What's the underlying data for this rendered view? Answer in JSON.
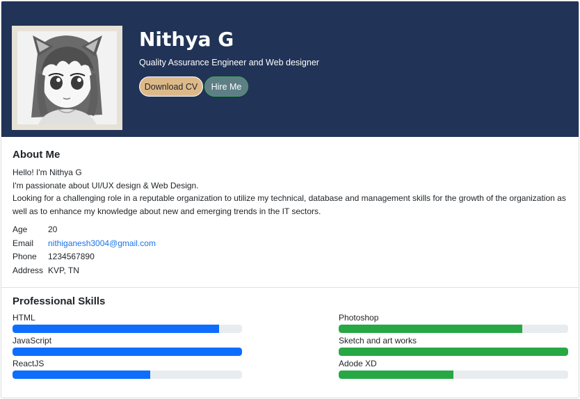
{
  "header": {
    "name": "Nithya G",
    "role": "Quality Assurance Engineer and Web designer",
    "download_label": "Download CV",
    "hire_label": "Hire Me"
  },
  "about": {
    "title": "About Me",
    "lines": [
      "Hello! I'm Nithya G",
      "I'm passionate about UI/UX design & Web Design.",
      "Looking for a challenging role in a reputable organization to utilize my technical, database and management skills for the growth of the organization as well as to enhance my knowledge about new and emerging trends in the IT sectors."
    ],
    "info": [
      {
        "label": "Age",
        "value": "20"
      },
      {
        "label": "Email",
        "value": "nithiganesh3004@gmail.com"
      },
      {
        "label": "Phone",
        "value": "1234567890"
      },
      {
        "label": "Address",
        "value": "KVP, TN"
      }
    ]
  },
  "skills": {
    "title": "Professional Skills",
    "left": [
      {
        "name": "HTML",
        "percent": 90
      },
      {
        "name": "JavaScript",
        "percent": 100
      },
      {
        "name": "ReactJS",
        "percent": 60
      }
    ],
    "right": [
      {
        "name": "Photoshop",
        "percent": 80
      },
      {
        "name": "Sketch and art works",
        "percent": 100
      },
      {
        "name": "Adode XD",
        "percent": 50
      }
    ]
  },
  "colors": {
    "header_bg": "#213356",
    "blue_bar": "#0d6efd",
    "green_bar": "#28a745"
  }
}
